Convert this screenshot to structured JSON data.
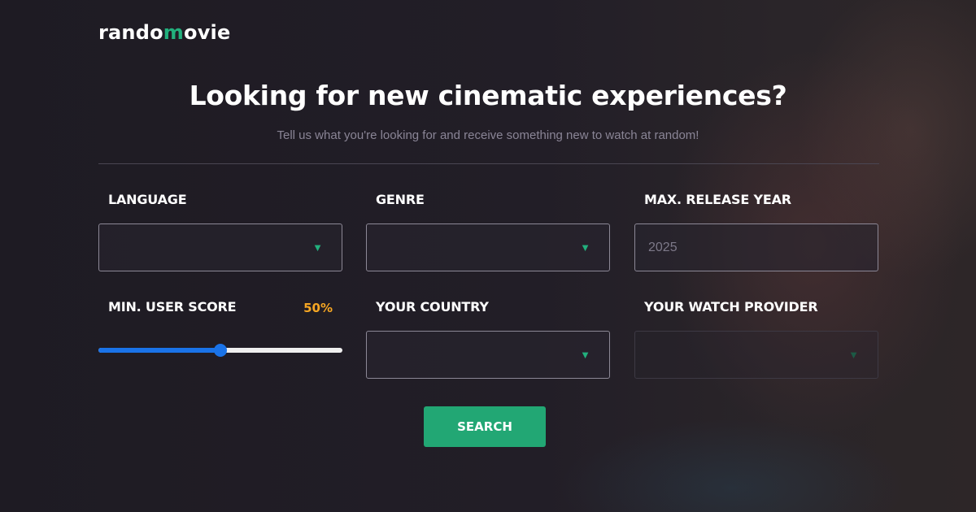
{
  "brand": {
    "prefix": "rando",
    "accent": "m",
    "suffix": "ovie",
    "accent_color": "#22b07d"
  },
  "hero": {
    "title": "Looking for new cinematic experiences?",
    "subtitle": "Tell us what you're looking for and receive something new to watch at random!"
  },
  "form": {
    "language": {
      "label": "LANGUAGE",
      "value": "",
      "icon": "chevron-down-icon"
    },
    "genre": {
      "label": "GENRE",
      "value": "",
      "icon": "chevron-down-icon"
    },
    "release_year": {
      "label": "MAX. RELEASE YEAR",
      "placeholder": "2025",
      "value": ""
    },
    "user_score": {
      "label": "MIN. USER SCORE",
      "display": "50%",
      "value": 0.5,
      "accent_color": "#f5a623"
    },
    "country": {
      "label": "YOUR COUNTRY",
      "value": "",
      "icon": "chevron-down-icon"
    },
    "watch_provider": {
      "label": "YOUR WATCH PROVIDER",
      "value": "",
      "disabled": true,
      "icon": "chevron-down-icon"
    }
  },
  "actions": {
    "search_label": "SEARCH",
    "search_color": "#22a774"
  }
}
